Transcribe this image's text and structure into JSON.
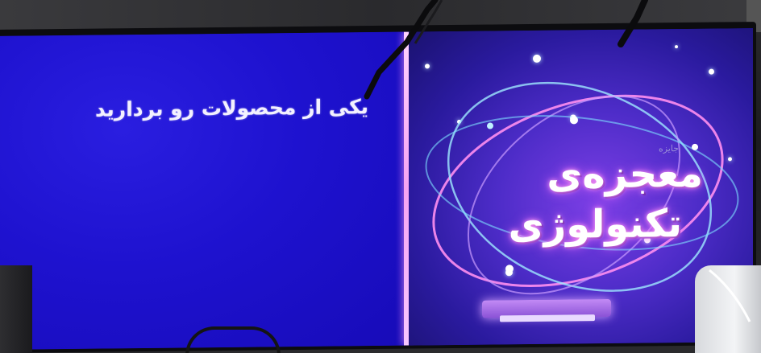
{
  "screen": {
    "instruction_text": "یکی از محصولات رو بردارید",
    "brand": {
      "line1": "معجزه‌ی",
      "line2": "تکنولوژی",
      "tag": "جایزه"
    }
  },
  "colors": {
    "screen_blue": "#1d10c9",
    "divider_pink": "#f6a3f2",
    "brand_glow": "#e86bff",
    "background_purple": "#4d2cc8"
  }
}
